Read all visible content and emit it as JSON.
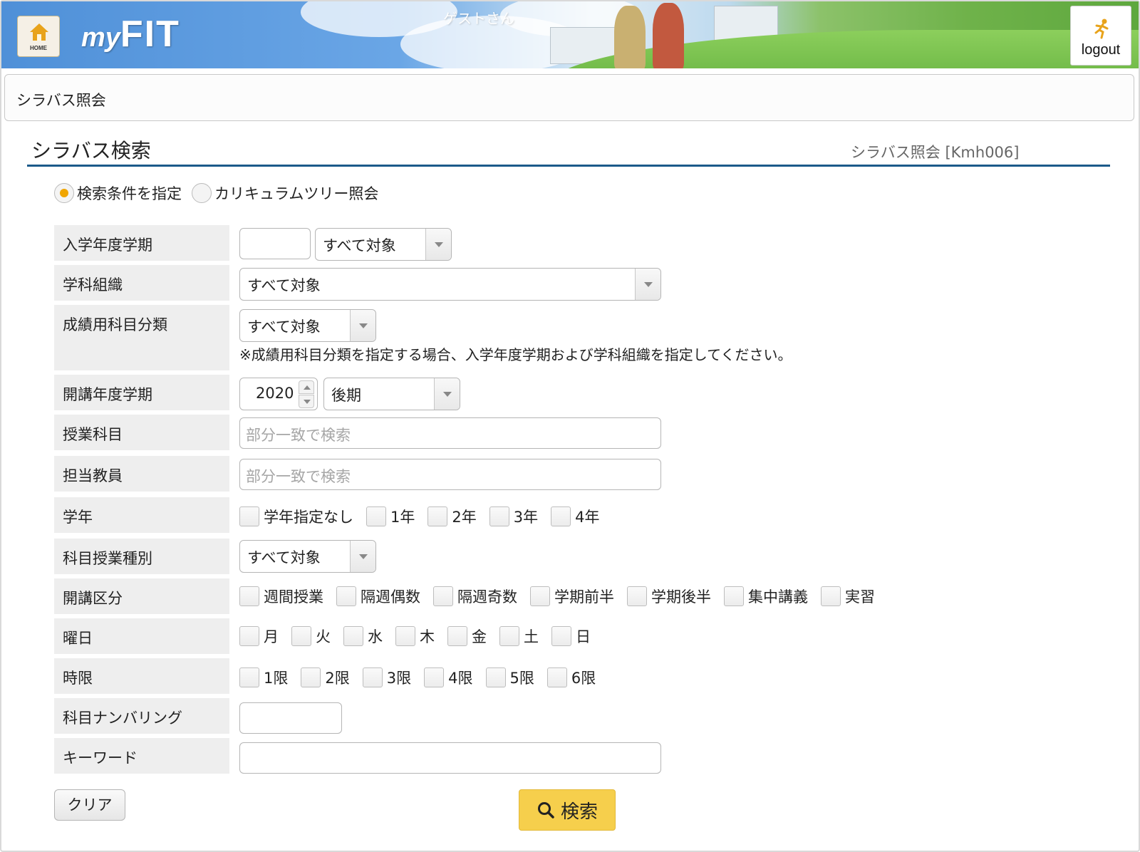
{
  "header": {
    "home_label": "HOME",
    "logo_my": "my",
    "logo_fit": "FIT",
    "guest": "ゲストさん",
    "logout": "logout"
  },
  "breadcrumb": "シラバス照会",
  "page": {
    "title": "シラバス検索",
    "id": "シラバス照会 [Kmh006]"
  },
  "mode": {
    "options": [
      "検索条件を指定",
      "カリキュラムツリー照会"
    ],
    "selected": "検索条件を指定"
  },
  "form": {
    "admission": {
      "label": "入学年度学期",
      "year_value": "",
      "term_value": "すべて対象"
    },
    "department": {
      "label": "学科組織",
      "value": "すべて対象"
    },
    "grade_category": {
      "label": "成績用科目分類",
      "value": "すべて対象",
      "note": "※成績用科目分類を指定する場合、入学年度学期および学科組織を指定してください。"
    },
    "offering": {
      "label": "開講年度学期",
      "year_value": "2020",
      "term_value": "後期"
    },
    "course": {
      "label": "授業科目",
      "placeholder": "部分一致で検索"
    },
    "instructor": {
      "label": "担当教員",
      "placeholder": "部分一致で検索"
    },
    "year_level": {
      "label": "学年",
      "options": [
        "学年指定なし",
        "1年",
        "2年",
        "3年",
        "4年"
      ]
    },
    "class_type": {
      "label": "科目授業種別",
      "value": "すべて対象"
    },
    "schedule_type": {
      "label": "開講区分",
      "options": [
        "週間授業",
        "隔週偶数",
        "隔週奇数",
        "学期前半",
        "学期後半",
        "集中講義",
        "実習"
      ]
    },
    "weekday": {
      "label": "曜日",
      "options": [
        "月",
        "火",
        "水",
        "木",
        "金",
        "土",
        "日"
      ]
    },
    "period": {
      "label": "時限",
      "options": [
        "1限",
        "2限",
        "3限",
        "4限",
        "5限",
        "6限"
      ]
    },
    "numbering": {
      "label": "科目ナンバリング",
      "value": ""
    },
    "keyword": {
      "label": "キーワード",
      "value": ""
    }
  },
  "buttons": {
    "clear": "クリア",
    "search": "検索"
  },
  "colors": {
    "accent": "#f6cf4c",
    "title_rule": "#1b5a8a",
    "radio_selected": "#f0a500"
  }
}
